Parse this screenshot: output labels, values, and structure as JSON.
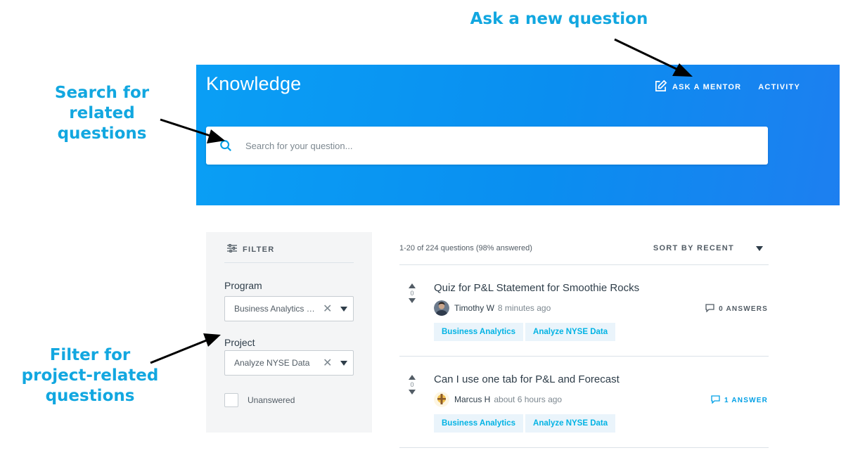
{
  "annotations": {
    "ask": "Ask a new question",
    "search_line1": "Search for related",
    "search_line2": "questions",
    "filter_line1": "Filter for",
    "filter_line2": "project-related",
    "filter_line3": "questions"
  },
  "colors": {
    "annotation": "#12a7e0",
    "hero_bg": "#0a95f2",
    "tag_bg": "#eaf4fb",
    "tag_text": "#02b3e4",
    "answered_accent": "#02a0e6"
  },
  "header": {
    "title": "Knowledge",
    "nav": [
      {
        "label": "ASK A MENTOR",
        "icon": "edit-icon"
      },
      {
        "label": "ACTIVITY"
      }
    ]
  },
  "search": {
    "icon": "search-icon",
    "placeholder": "Search for your question..."
  },
  "filter": {
    "heading": "FILTER",
    "icon": "sliders-icon",
    "program_label": "Program",
    "program_value": "Business Analytics Nanodegree",
    "project_label": "Project",
    "project_value": "Analyze NYSE Data",
    "checkbox_label": "Unanswered"
  },
  "results": {
    "count": "1-20 of 224 questions (98% answered)",
    "sort_label": "SORT BY RECENT",
    "questions": [
      {
        "votes": "0",
        "title": "Quiz for P&L Statement for Smoothie Rocks",
        "author": "Timothy W",
        "time": "8 minutes ago",
        "answers": "0 ANSWERS",
        "tags": [
          "Business Analytics",
          "Analyze NYSE Data"
        ]
      },
      {
        "votes": "0",
        "title": "Can I use one tab for P&L and Forecast",
        "author": "Marcus H",
        "time": "about 6 hours ago",
        "answers": "1 ANSWER",
        "tags": [
          "Business Analytics",
          "Analyze NYSE Data"
        ]
      }
    ]
  }
}
